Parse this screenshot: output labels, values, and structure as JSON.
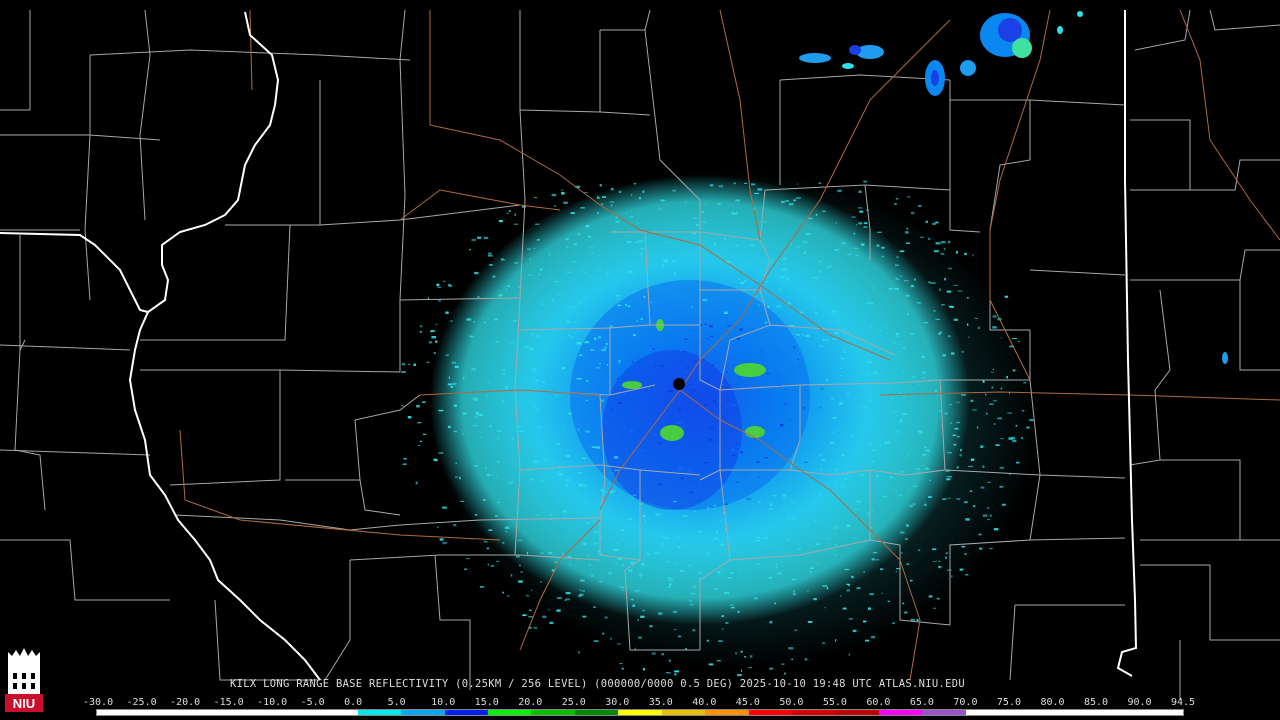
{
  "caption": "KILX LONG RANGE BASE REFLECTIVITY (0.25KM / 256 LEVEL) (000000/0000 0.5 DEG) 2025-10-10 19:48 UTC  ATLAS.NIU.EDU",
  "logo_text": "NIU",
  "scale_labels": [
    "-30.0",
    "-25.0",
    "-20.0",
    "-15.0",
    "-10.0",
    "-5.0",
    "0.0",
    "5.0",
    "10.0",
    "15.0",
    "20.0",
    "25.0",
    "30.0",
    "35.0",
    "40.0",
    "45.0",
    "50.0",
    "55.0",
    "60.0",
    "65.0",
    "70.0",
    "75.0",
    "80.0",
    "85.0",
    "90.0",
    "94.5"
  ],
  "colorbar_colors": [
    "#ffffff",
    "#ffffff",
    "#ffffff",
    "#ffffff",
    "#ffffff",
    "#ffffff",
    "#00e8e8",
    "#00a8f0",
    "#0020f0",
    "#00f000",
    "#00c000",
    "#008800",
    "#ffff00",
    "#e8c000",
    "#ff9000",
    "#ff0000",
    "#d60000",
    "#c00000",
    "#ff00ff",
    "#9955c8",
    "#ffffff",
    "#ffffff",
    "#ffffff",
    "#ffffff",
    "#ffffff"
  ],
  "colors": {
    "background": "#000000",
    "county_lines": "#a8a8a8",
    "state_lines": "#ffffff",
    "roads": "#b06a3c",
    "echo_light": "#30e0e8",
    "echo_mid": "#00a0f0",
    "echo_dark": "#1030e0",
    "echo_green": "#50e030",
    "radar_site": "#000000"
  },
  "icons": {
    "radar_site": "radar-site-icon",
    "logo": "niu-logo-icon"
  }
}
